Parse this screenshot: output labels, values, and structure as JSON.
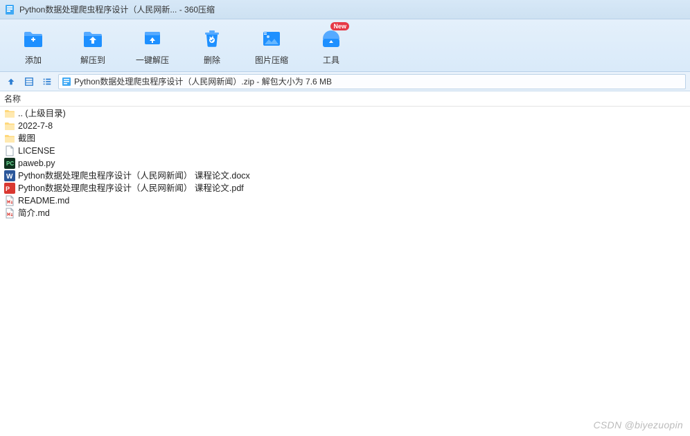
{
  "title_bar": {
    "title": "Python数据处理爬虫程序设计（人民网新... - 360压缩"
  },
  "toolbar": {
    "add": {
      "label": "添加"
    },
    "extract_to": {
      "label": "解压到"
    },
    "one_click": {
      "label": "一键解压"
    },
    "delete": {
      "label": "删除"
    },
    "image_compress": {
      "label": "图片压缩"
    },
    "tools": {
      "label": "工具",
      "badge": "New"
    }
  },
  "nav": {
    "path": "Python数据处理爬虫程序设计（人民网新闻）.zip - 解包大小为 7.6 MB"
  },
  "column_header": {
    "name": "名称"
  },
  "files": [
    {
      "icon": "folder-up",
      "name": ".. (上级目录)"
    },
    {
      "icon": "folder",
      "name": "2022-7-8"
    },
    {
      "icon": "folder",
      "name": "截图"
    },
    {
      "icon": "file-blank",
      "name": "LICENSE"
    },
    {
      "icon": "pycharm",
      "name": "paweb.py"
    },
    {
      "icon": "word",
      "name": "Python数据处理爬虫程序设计（人民网新闻） 课程论文.docx"
    },
    {
      "icon": "pdf",
      "name": "Python数据处理爬虫程序设计（人民网新闻） 课程论文.pdf"
    },
    {
      "icon": "md",
      "name": "README.md"
    },
    {
      "icon": "md",
      "name": "简介.md"
    }
  ],
  "watermark": "CSDN @biyezuopin"
}
